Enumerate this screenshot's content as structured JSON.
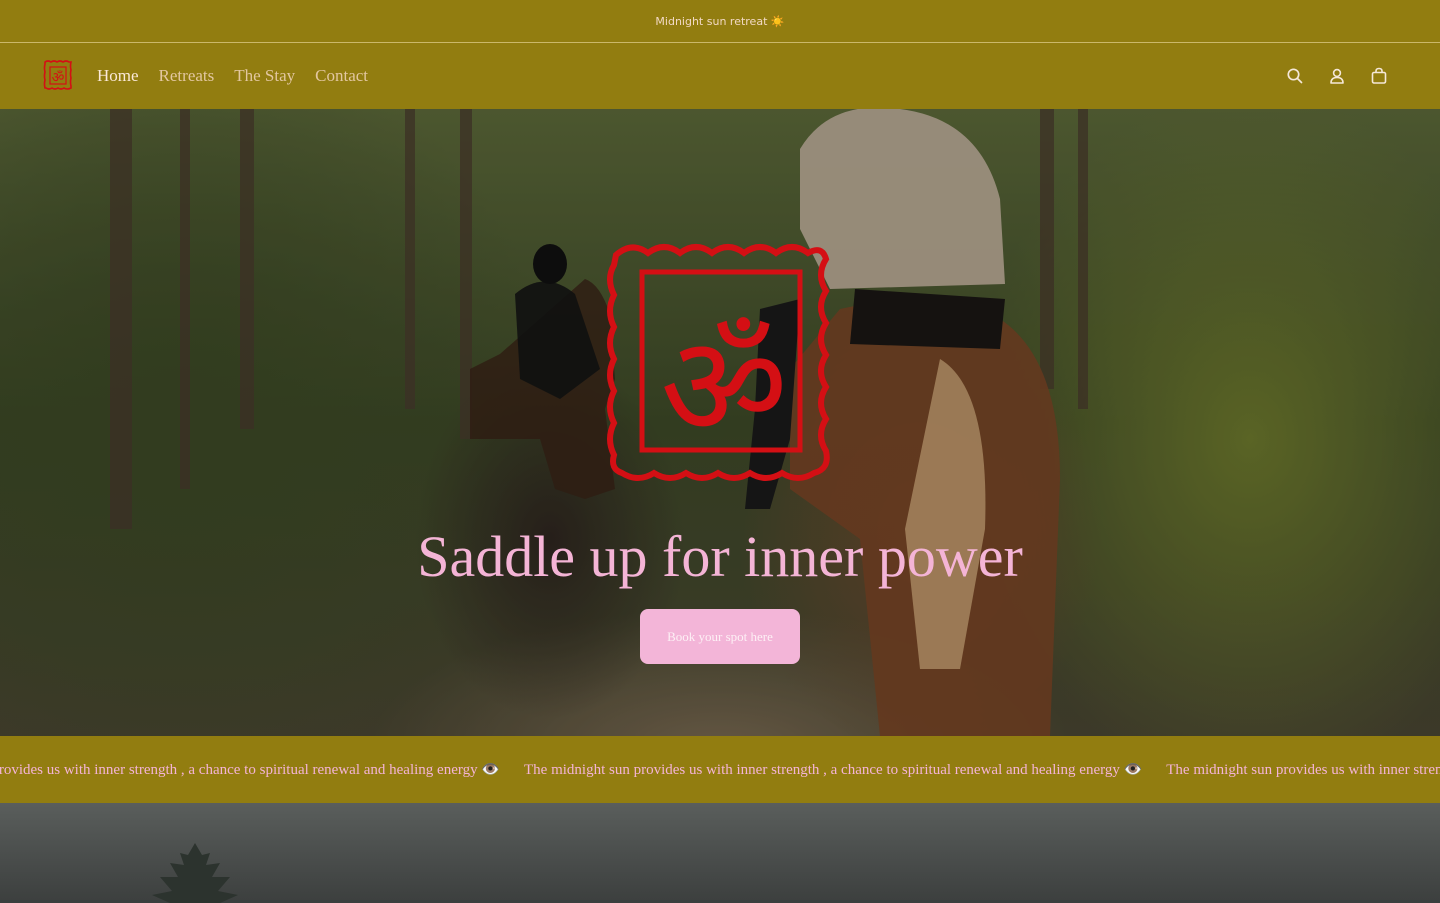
{
  "announcement": {
    "text": "Midnight sun retreat ☀️"
  },
  "header": {
    "logo": "om-horseshoe-logo",
    "nav": [
      {
        "label": "Home",
        "active": true
      },
      {
        "label": "Retreats",
        "active": false
      },
      {
        "label": "The Stay",
        "active": false
      },
      {
        "label": "Contact",
        "active": false
      }
    ],
    "icons": [
      "search-icon",
      "account-icon",
      "cart-icon"
    ]
  },
  "hero": {
    "logo_text": "ॐ",
    "title": "Saddle up for inner power",
    "button_label": "Book your spot here"
  },
  "marquee": {
    "items": [
      "nlight sun provides us with inner strength , a chance to spiritual renewal and healing energy 👁️",
      "The midnight sun provides us with inner strength , a chance to spiritual renewal and healing energy 👁️",
      "The midnight sun provides us with inner strength , a chance to spiritual renewal and healing energy 👁️"
    ]
  },
  "colors": {
    "bar": "#927d10",
    "accent_pink": "#f3b5d8",
    "logo_red": "#d40f14",
    "nav_text": "#e3c7a0"
  }
}
